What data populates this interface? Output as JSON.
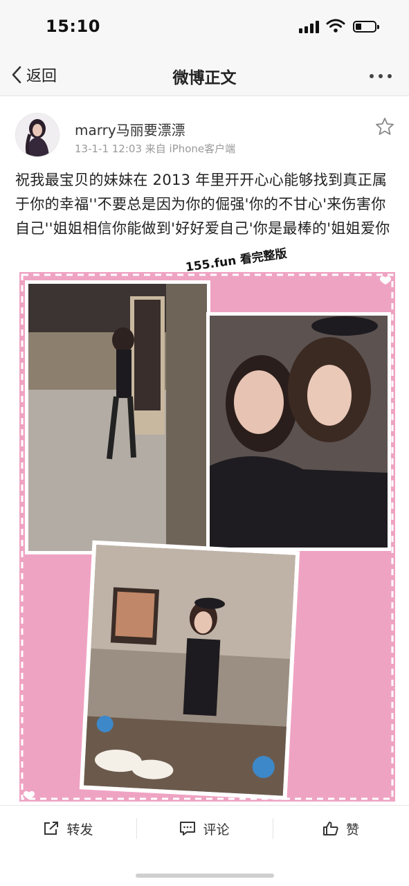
{
  "status_bar": {
    "time": "15:10"
  },
  "nav": {
    "back_label": "返回",
    "title": "微博正文"
  },
  "post": {
    "username": "marry马丽要漂漂",
    "meta": "13-1-1 12:03  来自 iPhone客户端",
    "text": "祝我最宝贝的妹妹在 2013 年里开开心心能够找到真正属于你的幸福''不要总是因为你的倔强'你的不甘心'来伤害你自己''姐姐相信你能做到'好好爱自己'你是最棒的'姐姐爱你",
    "image_watermark": "155.fun 看完整版"
  },
  "actions": {
    "repost_label": "转发",
    "comment_label": "评论",
    "like_label": "赞"
  },
  "colors": {
    "collage_pink": "#f0a5c4",
    "nav_bg": "#f7f7f7",
    "meta_gray": "#999999"
  },
  "icons": [
    "signal-icon",
    "wifi-icon",
    "battery-icon",
    "back-chevron-icon",
    "more-icon",
    "star-icon",
    "repost-icon",
    "comment-icon",
    "like-icon"
  ]
}
